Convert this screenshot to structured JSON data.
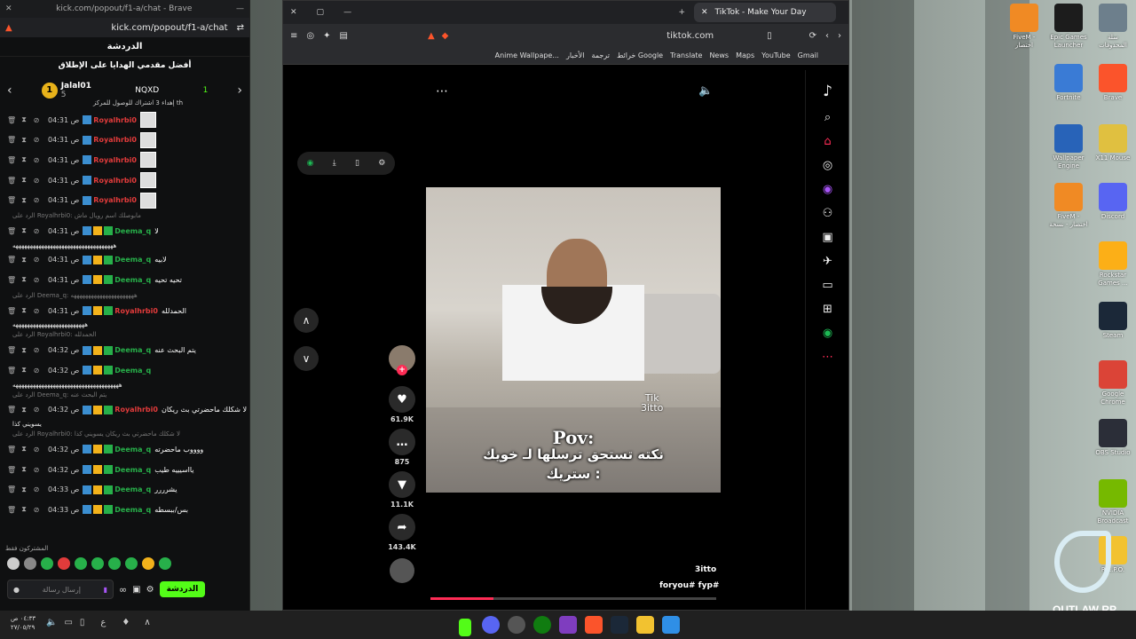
{
  "kick": {
    "titlebar_url": "kick.com/popout/f1-a/chat - Brave",
    "address": "kick.com/popout/f1-a/chat",
    "chat_title": "الدردشة",
    "leaderboard_title": "أفضل مقدمي الهدايا على الإطلاق",
    "leaderboard": {
      "first": {
        "rank": "1",
        "name": "Jalal01",
        "count": "5"
      },
      "second": {
        "name": "NQXD"
      },
      "third": {
        "count": "1"
      },
      "caption": "إهداء 3 اشتراك للوصول للمركز th"
    },
    "messages": [
      {
        "time": "04:31 ص",
        "user": "Royalhrbi0",
        "color": "#e23b3b",
        "text": "",
        "avatar": true
      },
      {
        "time": "04:31 ص",
        "user": "Royalhrbi0",
        "color": "#e23b3b",
        "text": "",
        "avatar": true
      },
      {
        "time": "04:31 ص",
        "user": "Royalhrbi0",
        "color": "#e23b3b",
        "text": "",
        "avatar": true
      },
      {
        "time": "04:31 ص",
        "user": "Royalhrbi0",
        "color": "#e23b3b",
        "text": "",
        "avatar": true
      },
      {
        "time": "04:31 ص",
        "user": "Royalhrbi0",
        "color": "#e23b3b",
        "text": "",
        "avatar": true
      },
      {
        "reply": "الرد على Royalhrbi0: مابوصلك اسم رويال ماش"
      },
      {
        "time": "04:31 ص",
        "user": "Deema_q",
        "color": "#27b04a",
        "text": "لا"
      },
      {
        "cont": "هههههههههههههههههههههههههههههههههههه"
      },
      {
        "time": "04:31 ص",
        "user": "Deema_q",
        "color": "#27b04a",
        "text": "لابيه"
      },
      {
        "time": "04:31 ص",
        "user": "Deema_q",
        "color": "#27b04a",
        "text": "تحيه تحيه"
      },
      {
        "reply": "الرد على Deema_q: ههههههههههههههههههههههه"
      },
      {
        "time": "04:31 ص",
        "user": "Royalhrbi0",
        "color": "#e23b3b",
        "text": "الحمدلله"
      },
      {
        "cont": "هههههههههههههههههههههههههه"
      },
      {
        "reply": "الرد على Royalhrbi0: الحمدلله"
      },
      {
        "time": "04:32 ص",
        "user": "Deema_q",
        "color": "#27b04a",
        "text": "يتم البحث عنه"
      },
      {
        "time": "04:32 ص",
        "user": "Deema_q",
        "color": "#27b04a",
        "text": ""
      },
      {
        "cont": "هههههههههههههههههههههههههههههههههههههه"
      },
      {
        "reply": "الرد على Deema_q: يتم البحث عنه"
      },
      {
        "time": "04:32 ص",
        "user": "Royalhrbi0",
        "color": "#e23b3b",
        "text": "لا شكلك ماحضرتي بث ريكان"
      },
      {
        "cont": "يسويني كذا"
      },
      {
        "reply": "الرد على Royalhrbi0: لا شكلك ماحضرتي بث ريكان يسويني كذا"
      },
      {
        "time": "04:32 ص",
        "user": "Deema_q",
        "color": "#27b04a",
        "text": "ووووب ماحضرته"
      },
      {
        "time": "04:32 ص",
        "user": "Deema_q",
        "color": "#27b04a",
        "text": "يااسيييه طيب"
      },
      {
        "time": "04:33 ص",
        "user": "Deema_q",
        "color": "#27b04a",
        "text": "يشرررر"
      },
      {
        "time": "04:33 ص",
        "user": "Deema_q",
        "color": "#27b04a",
        "text": "بس/ببسطه"
      }
    ],
    "subs_only": "المشتركون فقط",
    "input_placeholder": "إرسال رسالة",
    "send_label": "الدردشة"
  },
  "tiktok": {
    "tab_title": "TikTok - Make Your Day",
    "address": "tiktok.com",
    "bookmarks": [
      "Anime Wallpape...",
      "الأخبار",
      "ترجمة",
      "خرائط Google",
      "Translate",
      "News",
      "Maps",
      "YouTube",
      "Gmail"
    ],
    "video_text": {
      "pov": "Pov:",
      "line1": "نكته تستحق ترسلها لـ خويك",
      "line2": "ستريك :",
      "wm1": "Tik",
      "wm2": "3itto"
    },
    "likes": "61.9K",
    "comments": "875",
    "saves": "11.1K",
    "shares": "143.4K",
    "author": "3itto",
    "tags": "foryou# fyp#",
    "progress": 0.22,
    "brand_color": "#fe2c55"
  },
  "desktop": {
    "icons": [
      {
        "label": "FiveM - اختصار",
        "color": "#f08a24"
      },
      {
        "label": "Epic Games Launcher",
        "color": "#1c1c1c"
      },
      {
        "label": "سلة المحذوفات",
        "color": "#6d7f8c"
      },
      {
        "label": "Fortnite",
        "color": "#3a7bd5"
      },
      {
        "label": "Brave",
        "color": "#fb542b"
      },
      {
        "label": "Wallpaper Engine",
        "color": "#2863b8"
      },
      {
        "label": "X11 Mouse",
        "color": "#e0c040"
      },
      {
        "label": "FiveM - اختصار - نسخة",
        "color": "#f08a24"
      },
      {
        "label": "Discord",
        "color": "#5865f2"
      },
      {
        "label": "Rockstar Games ...",
        "color": "#fcaf17"
      },
      {
        "label": "Steam",
        "color": "#1b2838"
      },
      {
        "label": "Google Chrome",
        "color": "#db4437"
      },
      {
        "label": "OBS Studio",
        "color": "#2b2e38"
      },
      {
        "label": "NVIDIA Broadcast",
        "color": "#76b900"
      },
      {
        "label": "R.E.P.O.",
        "color": "#f2c230"
      }
    ],
    "outlaw": "OUTLAW RP"
  },
  "taskbar": {
    "time": "٠٤:٣٣ ص",
    "date": "٢٧/٠٥/٢٩",
    "lang": "ع"
  }
}
